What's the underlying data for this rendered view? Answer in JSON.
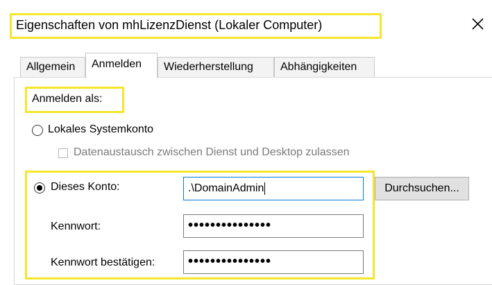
{
  "window": {
    "title": "Eigenschaften von mhLizenzDienst (Lokaler Computer)",
    "close_glyph": "✕"
  },
  "tabs": [
    {
      "label": "Allgemein",
      "active": false
    },
    {
      "label": "Anmelden",
      "active": true
    },
    {
      "label": "Wiederherstellung",
      "active": false
    },
    {
      "label": "Abhängigkeiten",
      "active": false
    }
  ],
  "logon": {
    "section_label": "Anmelden als:",
    "local_system": {
      "label": "Lokales Systemkonto",
      "checked": false
    },
    "desktop_interaction": {
      "label": "Datenaustausch zwischen Dienst und Desktop zulassen",
      "checked": false,
      "enabled": false
    },
    "this_account": {
      "label": "Dieses Konto:",
      "checked": true,
      "value": ".\\DomainAdmin"
    },
    "password": {
      "label": "Kennwort:",
      "value": "•••••••••••••••"
    },
    "confirm_password": {
      "label": "Kennwort bestätigen:",
      "value": "•••••••••••••••"
    },
    "browse_button": "Durchsuchen..."
  },
  "colors": {
    "highlight": "#f5e62a",
    "focus_border": "#0078d7"
  }
}
